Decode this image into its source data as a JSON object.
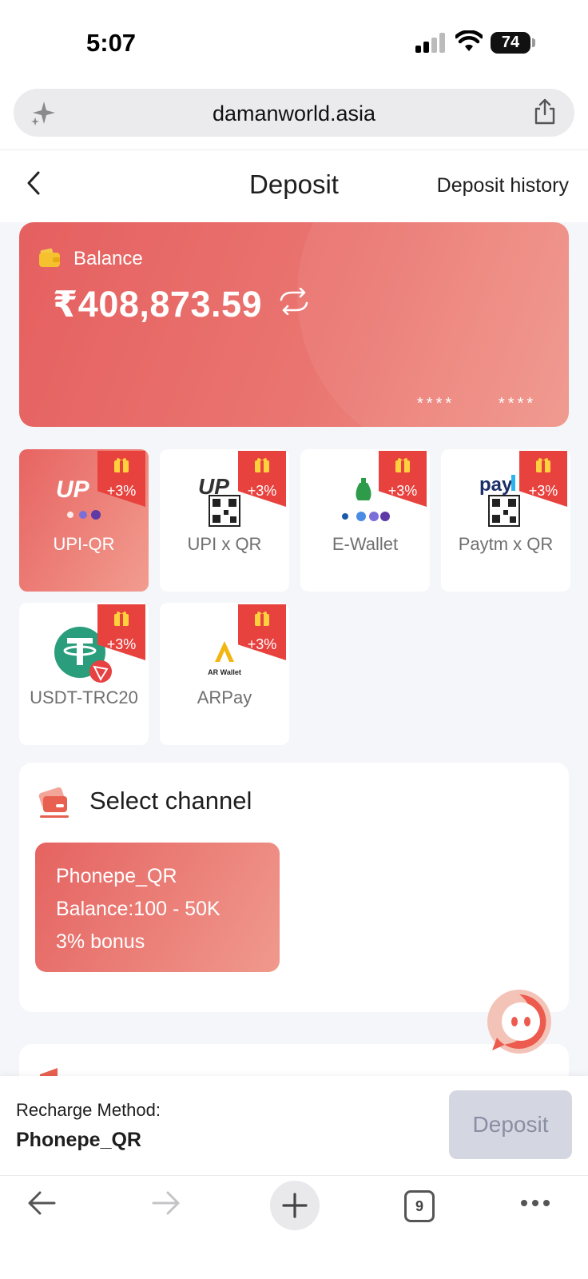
{
  "status_bar": {
    "time": "5:07",
    "battery": "74"
  },
  "browser": {
    "url": "damanworld.asia",
    "tab_count": "9"
  },
  "header": {
    "title": "Deposit",
    "history_link": "Deposit history"
  },
  "balance": {
    "label": "Balance",
    "amount": "₹408,873.59",
    "masked_1": "****",
    "masked_2": "****"
  },
  "methods": [
    {
      "label": "UPI-QR",
      "bonus": "+3%",
      "selected": true
    },
    {
      "label": "UPI x QR",
      "bonus": "+3%",
      "selected": false
    },
    {
      "label": "E-Wallet",
      "bonus": "+3%",
      "selected": false
    },
    {
      "label": "Paytm x QR",
      "bonus": "+3%",
      "selected": false
    },
    {
      "label": "USDT-TRC20",
      "bonus": "+3%",
      "selected": false
    },
    {
      "label": "ARPay",
      "bonus": "+3%",
      "selected": false,
      "logo_text": "AR Wallet"
    }
  ],
  "channel": {
    "title": "Select channel",
    "card": {
      "name": "Phonepe_QR",
      "range": "Balance:100 - 50K",
      "bonus": "3% bonus"
    }
  },
  "recharge": {
    "label": "Recharge Method:",
    "value": "Phonepe_QR",
    "button": "Deposit"
  },
  "colors": {
    "accent": "#e8604f",
    "badge": "#e8423f",
    "disabled_button": "#d4d6e1"
  }
}
